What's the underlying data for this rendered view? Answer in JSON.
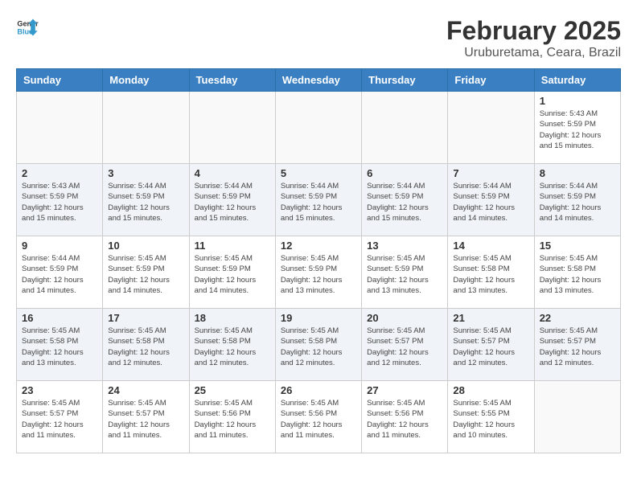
{
  "header": {
    "logo_general": "General",
    "logo_blue": "Blue",
    "title": "February 2025",
    "subtitle": "Uruburetama, Ceara, Brazil"
  },
  "weekdays": [
    "Sunday",
    "Monday",
    "Tuesday",
    "Wednesday",
    "Thursday",
    "Friday",
    "Saturday"
  ],
  "weeks": [
    [
      {
        "day": "",
        "info": ""
      },
      {
        "day": "",
        "info": ""
      },
      {
        "day": "",
        "info": ""
      },
      {
        "day": "",
        "info": ""
      },
      {
        "day": "",
        "info": ""
      },
      {
        "day": "",
        "info": ""
      },
      {
        "day": "1",
        "info": "Sunrise: 5:43 AM\nSunset: 5:59 PM\nDaylight: 12 hours\nand 15 minutes."
      }
    ],
    [
      {
        "day": "2",
        "info": "Sunrise: 5:43 AM\nSunset: 5:59 PM\nDaylight: 12 hours\nand 15 minutes."
      },
      {
        "day": "3",
        "info": "Sunrise: 5:44 AM\nSunset: 5:59 PM\nDaylight: 12 hours\nand 15 minutes."
      },
      {
        "day": "4",
        "info": "Sunrise: 5:44 AM\nSunset: 5:59 PM\nDaylight: 12 hours\nand 15 minutes."
      },
      {
        "day": "5",
        "info": "Sunrise: 5:44 AM\nSunset: 5:59 PM\nDaylight: 12 hours\nand 15 minutes."
      },
      {
        "day": "6",
        "info": "Sunrise: 5:44 AM\nSunset: 5:59 PM\nDaylight: 12 hours\nand 15 minutes."
      },
      {
        "day": "7",
        "info": "Sunrise: 5:44 AM\nSunset: 5:59 PM\nDaylight: 12 hours\nand 14 minutes."
      },
      {
        "day": "8",
        "info": "Sunrise: 5:44 AM\nSunset: 5:59 PM\nDaylight: 12 hours\nand 14 minutes."
      }
    ],
    [
      {
        "day": "9",
        "info": "Sunrise: 5:44 AM\nSunset: 5:59 PM\nDaylight: 12 hours\nand 14 minutes."
      },
      {
        "day": "10",
        "info": "Sunrise: 5:45 AM\nSunset: 5:59 PM\nDaylight: 12 hours\nand 14 minutes."
      },
      {
        "day": "11",
        "info": "Sunrise: 5:45 AM\nSunset: 5:59 PM\nDaylight: 12 hours\nand 14 minutes."
      },
      {
        "day": "12",
        "info": "Sunrise: 5:45 AM\nSunset: 5:59 PM\nDaylight: 12 hours\nand 13 minutes."
      },
      {
        "day": "13",
        "info": "Sunrise: 5:45 AM\nSunset: 5:59 PM\nDaylight: 12 hours\nand 13 minutes."
      },
      {
        "day": "14",
        "info": "Sunrise: 5:45 AM\nSunset: 5:58 PM\nDaylight: 12 hours\nand 13 minutes."
      },
      {
        "day": "15",
        "info": "Sunrise: 5:45 AM\nSunset: 5:58 PM\nDaylight: 12 hours\nand 13 minutes."
      }
    ],
    [
      {
        "day": "16",
        "info": "Sunrise: 5:45 AM\nSunset: 5:58 PM\nDaylight: 12 hours\nand 13 minutes."
      },
      {
        "day": "17",
        "info": "Sunrise: 5:45 AM\nSunset: 5:58 PM\nDaylight: 12 hours\nand 12 minutes."
      },
      {
        "day": "18",
        "info": "Sunrise: 5:45 AM\nSunset: 5:58 PM\nDaylight: 12 hours\nand 12 minutes."
      },
      {
        "day": "19",
        "info": "Sunrise: 5:45 AM\nSunset: 5:58 PM\nDaylight: 12 hours\nand 12 minutes."
      },
      {
        "day": "20",
        "info": "Sunrise: 5:45 AM\nSunset: 5:57 PM\nDaylight: 12 hours\nand 12 minutes."
      },
      {
        "day": "21",
        "info": "Sunrise: 5:45 AM\nSunset: 5:57 PM\nDaylight: 12 hours\nand 12 minutes."
      },
      {
        "day": "22",
        "info": "Sunrise: 5:45 AM\nSunset: 5:57 PM\nDaylight: 12 hours\nand 12 minutes."
      }
    ],
    [
      {
        "day": "23",
        "info": "Sunrise: 5:45 AM\nSunset: 5:57 PM\nDaylight: 12 hours\nand 11 minutes."
      },
      {
        "day": "24",
        "info": "Sunrise: 5:45 AM\nSunset: 5:57 PM\nDaylight: 12 hours\nand 11 minutes."
      },
      {
        "day": "25",
        "info": "Sunrise: 5:45 AM\nSunset: 5:56 PM\nDaylight: 12 hours\nand 11 minutes."
      },
      {
        "day": "26",
        "info": "Sunrise: 5:45 AM\nSunset: 5:56 PM\nDaylight: 12 hours\nand 11 minutes."
      },
      {
        "day": "27",
        "info": "Sunrise: 5:45 AM\nSunset: 5:56 PM\nDaylight: 12 hours\nand 11 minutes."
      },
      {
        "day": "28",
        "info": "Sunrise: 5:45 AM\nSunset: 5:55 PM\nDaylight: 12 hours\nand 10 minutes."
      },
      {
        "day": "",
        "info": ""
      }
    ]
  ]
}
